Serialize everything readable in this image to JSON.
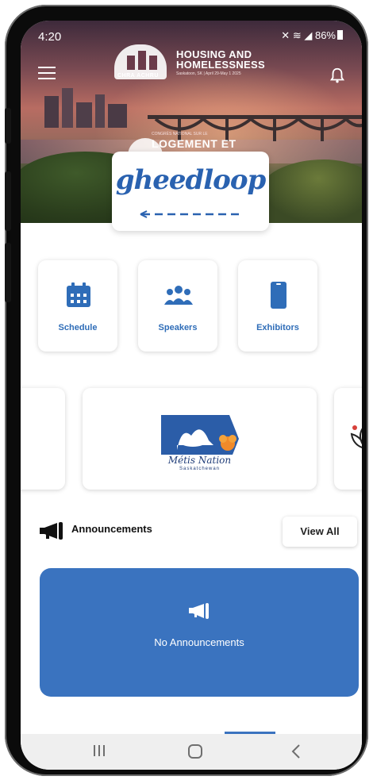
{
  "status_bar": {
    "time": "4:20",
    "battery": "86%"
  },
  "event": {
    "org_abbr": "CHRA ACHRU",
    "title_line1": "HOUSING AND",
    "title_line2": "HOMELESSNESS",
    "subtitle": "Saskatoon, SK | April 29-May 1 2025",
    "french_small": "CONGRÈS NATIONAL SUR LE",
    "french_title": "LOGEMENT ET"
  },
  "brand": {
    "name": "gheedloop"
  },
  "quick_actions": [
    {
      "label": "Schedule",
      "icon": "calendar-icon"
    },
    {
      "label": "Speakers",
      "icon": "people-icon"
    },
    {
      "label": "Exhibitors",
      "icon": "phone-icon"
    }
  ],
  "sponsors": {
    "center": {
      "name": "Métis Nation",
      "sub": "Saskatchewan"
    }
  },
  "announcements": {
    "title": "Announcements",
    "view_all": "View All",
    "empty_text": "No Announcements"
  },
  "colors": {
    "accent": "#3a73bf",
    "tile_label": "#2f6db8"
  }
}
